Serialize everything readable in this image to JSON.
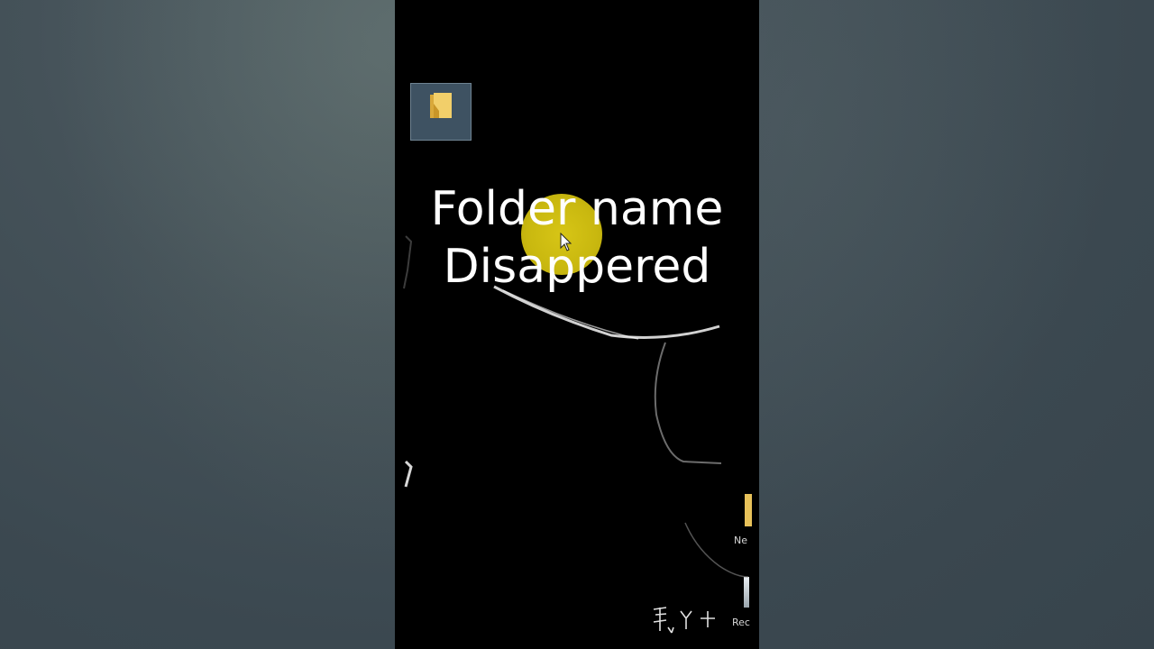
{
  "overlay": {
    "title_line1": "Folder name",
    "title_line2": "Disappered"
  },
  "desktop": {
    "selected_folder": {
      "label": "",
      "icon": "folder-icon"
    },
    "new_folder": {
      "label": "Ne",
      "icon": "folder-icon"
    },
    "recycle_bin": {
      "label": "Rec",
      "icon": "recycle-bin-icon"
    }
  },
  "colors": {
    "folder_yellow": "#e8c25a",
    "selection_tile": "#3e5262",
    "cursor_highlight": "#d7c516",
    "side_background": "#3d4c55"
  }
}
